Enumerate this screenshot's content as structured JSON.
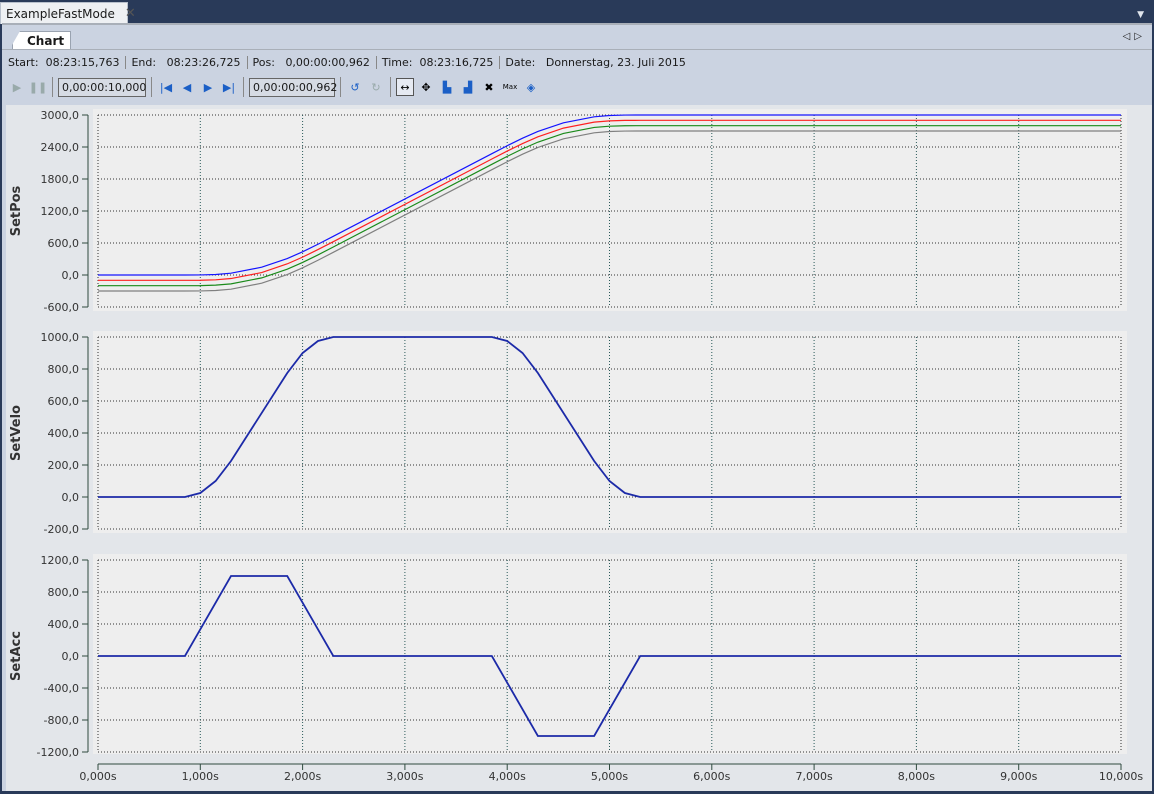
{
  "window": {
    "doc_tab": "ExampleFastMode",
    "close_icon": "close-icon",
    "menu_icon": "dropdown-arrow-icon"
  },
  "chart_tab": {
    "label": "Chart",
    "nav_left": "◁",
    "nav_right": "▷"
  },
  "info": {
    "start_label": "Start:",
    "start": "08:23:15,763",
    "end_label": "End:",
    "end": "08:23:26,725",
    "pos_label": "Pos:",
    "pos": "0,00:00:00,962",
    "time_label": "Time:",
    "time": "08:23:16,725",
    "date_label": "Date:",
    "date": "Donnerstag, 23. Juli 2015"
  },
  "toolbar": {
    "range": "0,00:00:10,000",
    "position": "0,00:00:00,962",
    "max_label": "Max"
  },
  "colors": {
    "blue": "#1414ff",
    "red": "#ff2020",
    "green": "#1a8a1a",
    "gray": "#808080",
    "navy": "#1c2aa8"
  },
  "chart_data": [
    {
      "type": "line",
      "ylabel": "SetPos",
      "ylim": [
        -600,
        3000
      ],
      "yticks": [
        "3000,0",
        "2400,0",
        "1800,0",
        "1200,0",
        "600,0",
        "0,0",
        "-600,0"
      ],
      "ytick_values": [
        3000,
        2400,
        1800,
        1200,
        600,
        0,
        -600
      ],
      "xlim": [
        0,
        10
      ],
      "grid": true,
      "x": [
        0,
        0.85,
        1.0,
        1.15,
        1.3,
        1.6,
        1.85,
        2.0,
        2.15,
        2.3,
        3.85,
        4.0,
        4.15,
        4.3,
        4.55,
        4.85,
        5.0,
        5.15,
        5.3,
        10
      ],
      "series": [
        {
          "color": "#1414ff",
          "values": [
            0,
            0,
            1.3,
            10,
            33.8,
            145.8,
            308.8,
            435,
            576.3,
            725,
            2275,
            2423.8,
            2565,
            2691.3,
            2854.3,
            2966.3,
            2990,
            2998.8,
            3000,
            3000
          ]
        },
        {
          "color": "#ff2020",
          "values": [
            -100,
            -100,
            -98.7,
            -90,
            -66.2,
            45.8,
            208.8,
            335,
            476.3,
            625,
            2175,
            2323.8,
            2465,
            2591.3,
            2754.3,
            2866.3,
            2890,
            2898.8,
            2900,
            2900
          ]
        },
        {
          "color": "#1a8a1a",
          "values": [
            -200,
            -200,
            -198.7,
            -190,
            -166.2,
            -54.2,
            108.8,
            235,
            376.3,
            525,
            2075,
            2223.8,
            2365,
            2491.3,
            2654.3,
            2766.3,
            2790,
            2798.8,
            2800,
            2800
          ]
        },
        {
          "color": "#808080",
          "values": [
            -300,
            -300,
            -298.7,
            -290,
            -266.2,
            -154.2,
            8.8,
            135,
            276.3,
            425,
            1975,
            2123.8,
            2265,
            2391.3,
            2554.3,
            2666.3,
            2690,
            2698.8,
            2700,
            2700
          ]
        }
      ]
    },
    {
      "type": "line",
      "ylabel": "SetVelo",
      "ylim": [
        -200,
        1000
      ],
      "yticks": [
        "1000,0",
        "800,0",
        "600,0",
        "400,0",
        "200,0",
        "0,0",
        "-200,0"
      ],
      "ytick_values": [
        1000,
        800,
        600,
        400,
        200,
        0,
        -200
      ],
      "xlim": [
        0,
        10
      ],
      "grid": true,
      "x": [
        0,
        0.85,
        1.0,
        1.15,
        1.3,
        1.85,
        2.0,
        2.15,
        2.3,
        3.85,
        4.0,
        4.15,
        4.3,
        4.85,
        5.0,
        5.15,
        5.3,
        10
      ],
      "series": [
        {
          "color": "#1c2aa8",
          "values": [
            0,
            0,
            25,
            100,
            225,
            775,
            900,
            975,
            1000,
            1000,
            975,
            900,
            775,
            225,
            100,
            25,
            0,
            0
          ]
        }
      ]
    },
    {
      "type": "line",
      "ylabel": "SetAcc",
      "ylim": [
        -1200,
        1200
      ],
      "yticks": [
        "1200,0",
        "800,0",
        "400,0",
        "0,0",
        "-400,0",
        "-800,0",
        "-1200,0"
      ],
      "ytick_values": [
        1200,
        800,
        400,
        0,
        -400,
        -800,
        -1200
      ],
      "xlim": [
        0,
        10
      ],
      "grid": true,
      "x": [
        0,
        0.85,
        1.3,
        1.85,
        2.3,
        3.85,
        4.3,
        4.85,
        5.3,
        10
      ],
      "series": [
        {
          "color": "#1c2aa8",
          "values": [
            0,
            0,
            1000,
            1000,
            0,
            0,
            -1000,
            -1000,
            0,
            0
          ]
        }
      ],
      "xticks": [
        "0,000s",
        "1,000s",
        "2,000s",
        "3,000s",
        "4,000s",
        "5,000s",
        "6,000s",
        "7,000s",
        "8,000s",
        "9,000s",
        "10,000s"
      ]
    }
  ]
}
